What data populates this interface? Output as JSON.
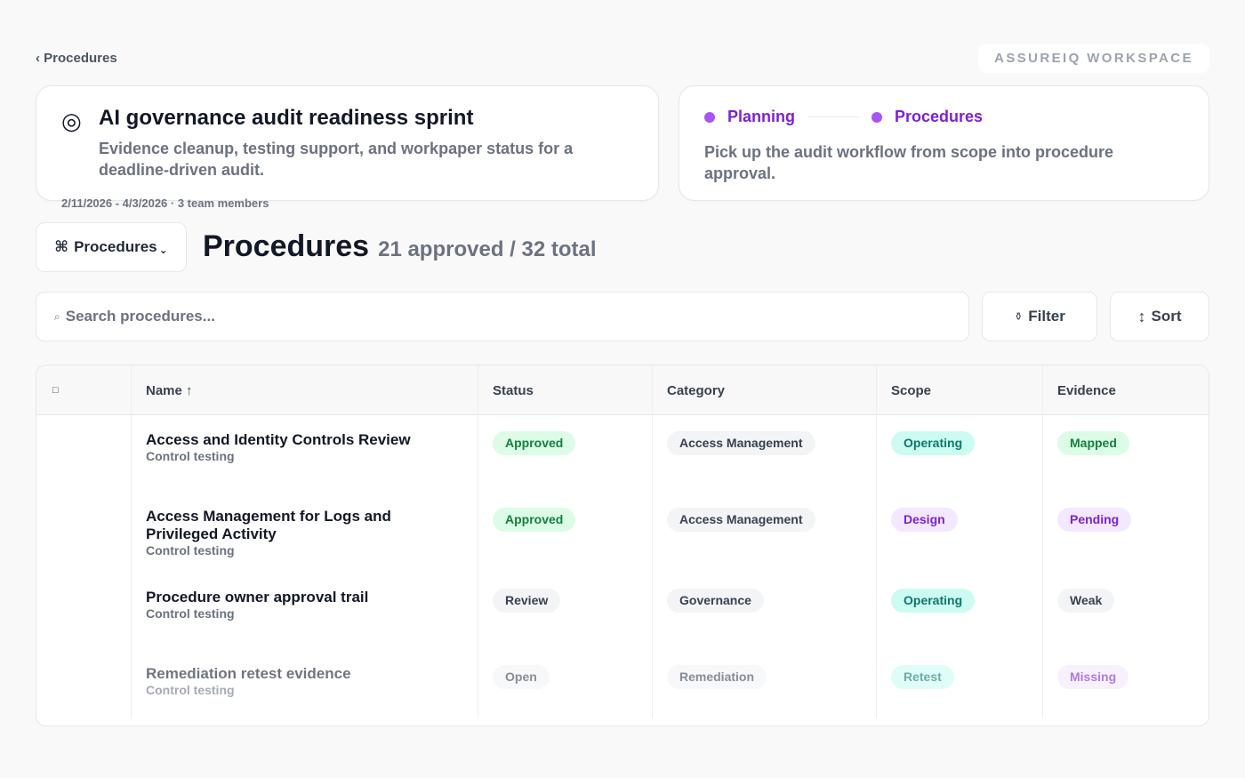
{
  "breadcrumb": {
    "back_label": "‹ Procedures"
  },
  "workspace": {
    "label": "ASSUREIQ WORKSPACE"
  },
  "project": {
    "icon": "target-icon",
    "title": "AI governance audit readiness sprint",
    "description": "Evidence cleanup, testing support, and workpaper status for a deadline-driven audit.",
    "meta": "2/11/2026 - 4/3/2026 · 3 team members"
  },
  "workflow": {
    "steps": [
      {
        "label": "Planning"
      },
      {
        "label": "Procedures"
      }
    ],
    "description": "Pick up the audit workflow from scope into procedure approval.",
    "step_color": "#7e22ce"
  },
  "section": {
    "dropdown_icon": "⌘",
    "dropdown_label": "Procedures",
    "title": "Procedures",
    "count": "21 approved / 32 total"
  },
  "search": {
    "icon": "search-icon",
    "placeholder": "Search procedures..."
  },
  "toolbar": {
    "filter_icon": "⚱",
    "filter_label": "Filter",
    "sort_icon": "↕",
    "sort_label": "Sort"
  },
  "table": {
    "checkbox_glyph": "□",
    "columns": [
      "Name ↑",
      "Status",
      "Category",
      "Scope",
      "Evidence"
    ],
    "rows": [
      {
        "name": "Access and Identity Controls Review",
        "sub": "Control testing",
        "status": "Approved",
        "category": "Access Management",
        "scope": "Operating",
        "evidence": "Mapped"
      },
      {
        "name": "Access Management for Logs and Privileged Activity",
        "sub": "Control testing",
        "status": "Approved",
        "category": "Access Management",
        "scope": "Design",
        "evidence": "Pending"
      },
      {
        "name": "Procedure owner approval trail",
        "sub": "Control testing",
        "status": "Review",
        "category": "Governance",
        "scope": "Operating",
        "evidence": "Weak"
      },
      {
        "name": "Remediation retest evidence",
        "sub": "Control testing",
        "status": "Open",
        "category": "Remediation",
        "scope": "Retest",
        "evidence": "Missing"
      }
    ]
  },
  "colors": {
    "green_bg": "#dcfce7",
    "green_text": "#15803d",
    "teal_bg": "#ccfbf1",
    "teal_text": "#0f766e",
    "purple_bg": "#f3e8ff",
    "purple_text": "#7e22ce",
    "gray_bg": "#f3f4f6",
    "gray_text": "#374151"
  }
}
